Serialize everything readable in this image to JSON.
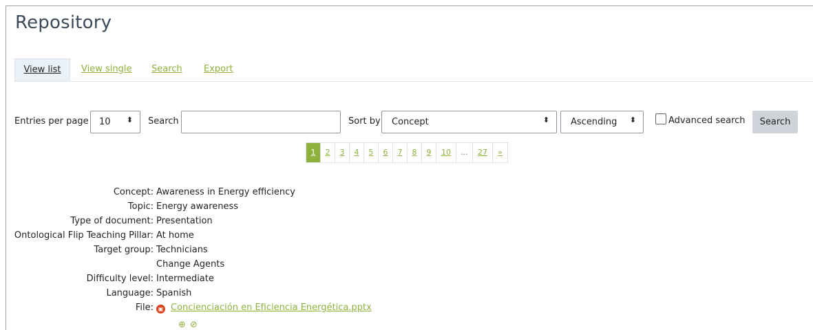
{
  "page": {
    "title": "Repository"
  },
  "tabs": [
    {
      "label": "View list",
      "active": true
    },
    {
      "label": "View single",
      "active": false
    },
    {
      "label": "Search",
      "active": false
    },
    {
      "label": "Export",
      "active": false
    }
  ],
  "toolbar": {
    "entries_label": "Entries per page",
    "entries_value": "10",
    "search_label": "Search",
    "search_value": "",
    "sort_label": "Sort by",
    "sort_value": "Concept",
    "order_value": "Ascending",
    "advanced_label": "Advanced search",
    "advanced_checked": false,
    "search_button": "Search"
  },
  "pagination": {
    "pages": [
      "1",
      "2",
      "3",
      "4",
      "5",
      "6",
      "7",
      "8",
      "9",
      "10",
      "...",
      "27",
      "»"
    ],
    "current": "1"
  },
  "record": {
    "concept": {
      "label": "Concept:",
      "value": "Awareness in Energy efficiency"
    },
    "topic": {
      "label": "Topic:",
      "value": "Energy awareness"
    },
    "doc_type": {
      "label": "Type of document:",
      "value": "Presentation"
    },
    "pillar": {
      "label": "Ontological Flip Teaching Pillar:",
      "value": "At home"
    },
    "target_group": {
      "label": "Target group:",
      "values": [
        "Technicians",
        "Change Agents"
      ]
    },
    "difficulty": {
      "label": "Difficulty level:",
      "value": "Intermediate"
    },
    "language": {
      "label": "Language:",
      "value": "Spanish"
    },
    "file": {
      "label": "File:",
      "name": "Concienciación en Eficiencia Energética.pptx"
    }
  },
  "colors": {
    "accent": "#8db13c",
    "file_icon": "#d9431e",
    "tab_active_bg": "#e9f1f7",
    "button_bg": "#ced4da"
  },
  "icons": {
    "file": "file-type-icon",
    "zoom": "zoom-icon",
    "disable": "disable-icon"
  }
}
